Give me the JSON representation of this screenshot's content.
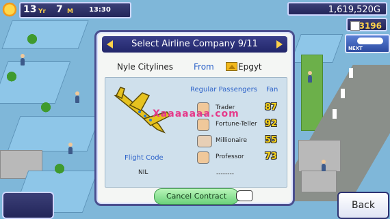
{
  "hud": {
    "year": "13",
    "year_unit": "Yr",
    "month": "7",
    "month_unit": "M",
    "time": "13:30",
    "money": "1,619,520G",
    "points": "3196",
    "next_label": "NEXT"
  },
  "dialog": {
    "title": "Select Airline Company 9/11",
    "airline_name": "Nyle Citylines",
    "from_label": "From",
    "country": "Epgyt",
    "passengers_header": "Regular Passengers",
    "fan_header": "Fan",
    "passengers": [
      {
        "name": "Trader",
        "fan": "87"
      },
      {
        "name": "Fortune-Teller",
        "fan": "92"
      },
      {
        "name": "Millionaire",
        "fan": "55"
      },
      {
        "name": "Professor",
        "fan": "73"
      }
    ],
    "flight_code_label": "Flight Code",
    "flight_code_value": "NIL",
    "placeholder_dashes": "--------",
    "cancel_label": "Cancel Contract"
  },
  "watermark_text": "Xaaaaaaa.com",
  "back_label": "Back",
  "colors": {
    "accent_blue": "#2c62c9",
    "fan_yellow": "#f6d21a",
    "dialog_frame": "#4a4f8f",
    "cancel_green": "#6bd27b"
  }
}
